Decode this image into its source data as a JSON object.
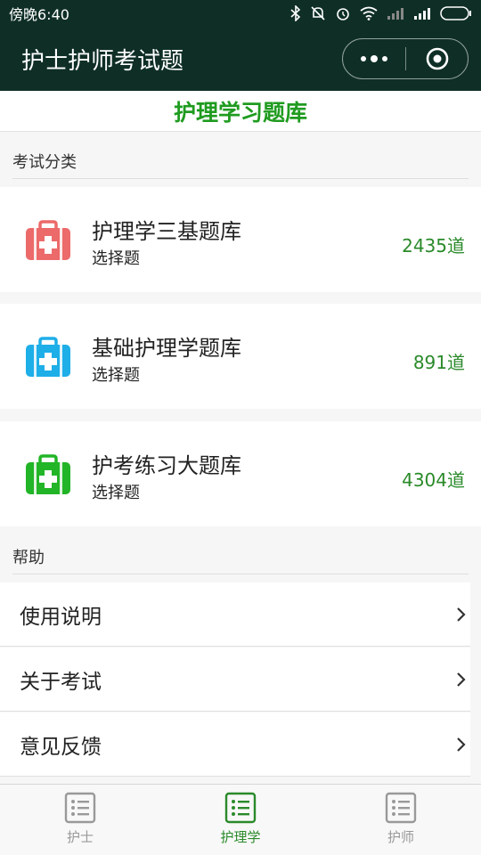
{
  "status_bar": {
    "time": "傍晚6:40"
  },
  "nav": {
    "title": "护士护师考试题"
  },
  "header": {
    "title": "护理学习题库"
  },
  "sections": {
    "categories_label": "考试分类",
    "help_label": "帮助"
  },
  "categories": [
    {
      "title": "护理学三基题库",
      "subtitle": "选择题",
      "count": "2435道",
      "icon": "first-aid-kit-icon",
      "color": "#ec6a6a"
    },
    {
      "title": "基础护理学题库",
      "subtitle": "选择题",
      "count": "891道",
      "icon": "first-aid-kit-icon",
      "color": "#1eaee8"
    },
    {
      "title": "护考练习大题库",
      "subtitle": "选择题",
      "count": "4304道",
      "icon": "first-aid-kit-icon",
      "color": "#22b527"
    }
  ],
  "help_items": [
    {
      "label": "使用说明"
    },
    {
      "label": "关于考试"
    },
    {
      "label": "意见反馈"
    }
  ],
  "tabs": [
    {
      "label": "护士",
      "icon": "list-icon",
      "active": false
    },
    {
      "label": "护理学",
      "icon": "list-icon",
      "active": true
    },
    {
      "label": "护师",
      "icon": "list-icon",
      "active": false
    }
  ],
  "colors": {
    "nav_bg": "#0f2f26",
    "accent": "#1f9b1f",
    "count_text": "#2a8a2a"
  }
}
